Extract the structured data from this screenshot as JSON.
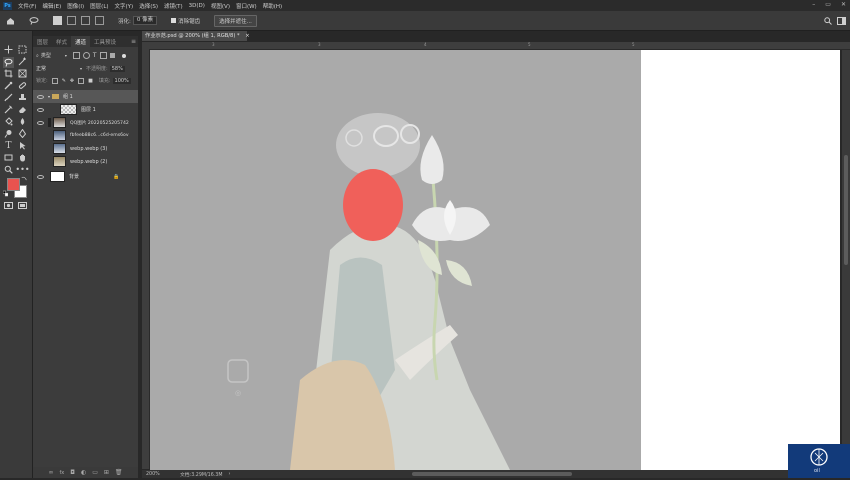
{
  "menu": {
    "logo": "Ps",
    "items": [
      "文件(F)",
      "编辑(E)",
      "图像(I)",
      "图层(L)",
      "文字(Y)",
      "选择(S)",
      "滤镜(T)",
      "3D(D)",
      "视图(V)",
      "窗口(W)",
      "帮助(H)"
    ],
    "window_controls": [
      "–",
      "▭",
      "✕"
    ]
  },
  "options": {
    "feather_label": "羽化:",
    "feather_value": "0 像素",
    "antialias_label": "消除锯齿",
    "select_mask_button": "选择并遮住..."
  },
  "layers_panel": {
    "tabs": [
      "图层",
      "样式",
      "通道",
      "工具预设"
    ],
    "kind_label": "类型",
    "blend_mode": "正常",
    "opacity_label": "不透明度:",
    "opacity_value": "58%",
    "lock_label": "锁定:",
    "fill_label": "填充:",
    "fill_value": "100%",
    "layers": [
      {
        "name": "组 1",
        "visible": true,
        "selected": true
      },
      {
        "name": "图层 1",
        "visible": true,
        "selected": false
      },
      {
        "name": "QQ图片 20220525205742",
        "visible": true,
        "selected": false
      },
      {
        "name": "fbfeeb88c6...c6d-ems6ov",
        "visible": false,
        "selected": false
      },
      {
        "name": "webp.webp (3)",
        "visible": false,
        "selected": false
      },
      {
        "name": "webp.webp (2)",
        "visible": false,
        "selected": false
      },
      {
        "name": "背景",
        "visible": true,
        "selected": false
      }
    ],
    "bottom_icons": [
      "link-icon",
      "fx-icon",
      "mask-icon",
      "adjustment-icon",
      "folder-icon",
      "new-layer-icon",
      "trash-icon"
    ]
  },
  "document": {
    "tab_title": "作业示范.psd @ 200% (组 1, RGB/8) *",
    "ruler_ticks": [
      "3",
      "3",
      "4",
      "5",
      "5"
    ],
    "zoom": "200%",
    "doc_size": "文档:3.29M/16.3M"
  },
  "colors": {
    "foreground": "#e8534f",
    "background": "#ffffff",
    "accent": "#31a8ff",
    "red_circle": "#f0605a"
  },
  "overlay_widget": {
    "label": "oil"
  }
}
